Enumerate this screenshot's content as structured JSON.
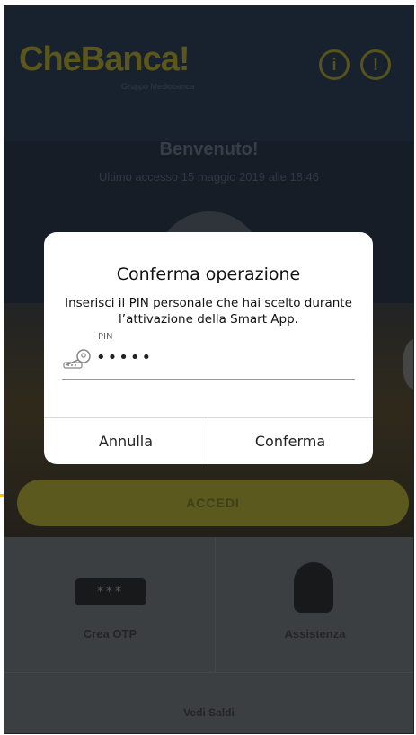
{
  "app": {
    "logo_text": "CheBanca!",
    "logo_subtitle": "Gruppo Mediobanca",
    "info_icon_glyph": "i",
    "location_icon_glyph": "!",
    "welcome_title": "Benvenuto!",
    "last_access": "Ultimo accesso 15 maggio 2019 alle 18:46",
    "login_button": "ACCEDI",
    "otp_icon_text": "***",
    "otp_label": "Crea OTP",
    "assist_label": "Assistenza",
    "balance_label": "Vedi Saldi"
  },
  "dialog": {
    "title": "Conferma operazione",
    "message": "Inserisci il PIN personale che hai scelto durante l’attivazione della Smart App.",
    "pin_label": "PIN",
    "pin_value": "•••••",
    "cancel_label": "Annulla",
    "confirm_label": "Conferma"
  },
  "icons": {
    "key": "key-icon",
    "info": "info-icon",
    "location": "location-icon",
    "otp": "otp-icon",
    "assistance": "headset-icon",
    "fingerprint": "fingerprint-icon"
  },
  "colors": {
    "brand_yellow": "#f5c400",
    "dialog_bg": "#ffffff",
    "app_bg": "#1e2a39"
  }
}
